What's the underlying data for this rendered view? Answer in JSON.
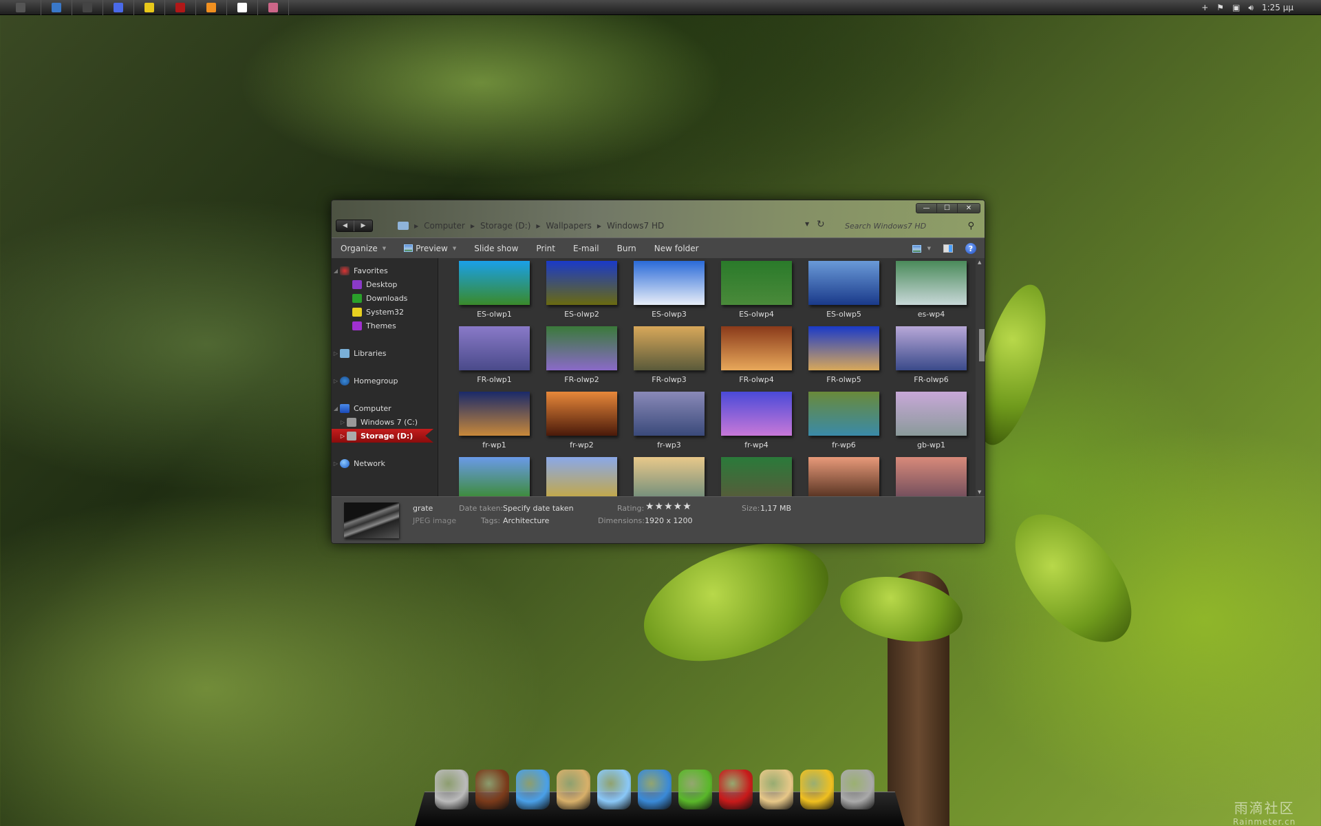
{
  "topbar": {
    "apps": [
      {
        "name": "apple-menu-icon",
        "color": "#555555"
      },
      {
        "name": "home-icon",
        "color": "#3a78c8"
      },
      {
        "name": "app-icon-dark",
        "color": "#444444"
      },
      {
        "name": "color-pen-icon",
        "color": "#4a6ae8"
      },
      {
        "name": "chrome-icon",
        "color": "#e8c81a"
      },
      {
        "name": "film-icon",
        "color": "#b01818"
      },
      {
        "name": "music-icon",
        "color": "#f09020"
      },
      {
        "name": "gmail-icon",
        "color": "#ffffff"
      },
      {
        "name": "paint-icon",
        "color": "#cc6688"
      }
    ],
    "tray": {
      "clock": "1:25 μμ"
    }
  },
  "window": {
    "nav_back": "◀",
    "nav_forward": "▶",
    "caption": {
      "minimize": "—",
      "maximize": "☐",
      "close": "✕"
    },
    "breadcrumb": [
      "Computer",
      "Storage (D:)",
      "Wallpapers",
      "Windows7 HD"
    ],
    "search_placeholder": "Search Windows7 HD",
    "toolbar": {
      "organize": "Organize",
      "preview": "Preview",
      "slideshow": "Slide show",
      "print": "Print",
      "email": "E-mail",
      "burn": "Burn",
      "new_folder": "New folder",
      "help": "?"
    },
    "nav_pane": {
      "favorites": "Favorites",
      "fav_items": [
        {
          "label": "Desktop",
          "color": "#8a3ac8"
        },
        {
          "label": "Downloads",
          "color": "#2aa02a"
        },
        {
          "label": "System32",
          "color": "#e8d020"
        },
        {
          "label": "Themes",
          "color": "#a030d0"
        }
      ],
      "libraries": "Libraries",
      "homegroup": "Homegroup",
      "computer": "Computer",
      "drives": [
        "Windows 7 (C:)",
        "Storage (D:)"
      ],
      "selected": "Storage (D:)",
      "network": "Network"
    },
    "files": [
      {
        "name": "ES-olwp1",
        "c1": "#1aa0e8",
        "c2": "#3a8a2a"
      },
      {
        "name": "ES-olwp2",
        "c1": "#1a3ac8",
        "c2": "#6a6a10"
      },
      {
        "name": "ES-olwp3",
        "c1": "#2a6ad8",
        "c2": "#e8eef8"
      },
      {
        "name": "ES-olwp4",
        "c1": "#2a7a2a",
        "c2": "#4a8a3a"
      },
      {
        "name": "ES-olwp5",
        "c1": "#6a9ad8",
        "c2": "#1a3a8a"
      },
      {
        "name": "es-wp4",
        "c1": "#4a8a5a",
        "c2": "#c8d8d8"
      },
      {
        "name": "FR-olwp1",
        "c1": "#8a7ac8",
        "c2": "#4a4a8a"
      },
      {
        "name": "FR-olwp2",
        "c1": "#3a7a3a",
        "c2": "#8a6ac8"
      },
      {
        "name": "FR-olwp3",
        "c1": "#d8a85a",
        "c2": "#5a5a3a"
      },
      {
        "name": "FR-olwp4",
        "c1": "#8a3a1a",
        "c2": "#e8a85a"
      },
      {
        "name": "FR-olwp5",
        "c1": "#1a3ac8",
        "c2": "#d8a85a"
      },
      {
        "name": "FR-olwp6",
        "c1": "#b8a8d8",
        "c2": "#3a4a8a"
      },
      {
        "name": "fr-wp1",
        "c1": "#1a2a6a",
        "c2": "#c8883a"
      },
      {
        "name": "fr-wp2",
        "c1": "#e8883a",
        "c2": "#4a1a0a"
      },
      {
        "name": "fr-wp3",
        "c1": "#8a8ab8",
        "c2": "#3a4a7a"
      },
      {
        "name": "fr-wp4",
        "c1": "#4a4ad8",
        "c2": "#c878d8"
      },
      {
        "name": "fr-wp6",
        "c1": "#6a8a3a",
        "c2": "#3a8aa8"
      },
      {
        "name": "gb-wp1",
        "c1": "#c8a8d8",
        "c2": "#8a9a9a"
      },
      {
        "name": "",
        "c1": "#6a9ae8",
        "c2": "#3a8a2a"
      },
      {
        "name": "",
        "c1": "#8aa8e8",
        "c2": "#c8a83a"
      },
      {
        "name": "",
        "c1": "#e8c88a",
        "c2": "#6a8a7a"
      },
      {
        "name": "",
        "c1": "#2a7a3a",
        "c2": "#5a5a3a"
      },
      {
        "name": "",
        "c1": "#e89a7a",
        "c2": "#4a2a1a"
      },
      {
        "name": "",
        "c1": "#d88a7a",
        "c2": "#6a4a5a"
      }
    ],
    "details": {
      "filename": "grate",
      "filetype": "JPEG image",
      "date_label": "Date taken:",
      "date_value": "Specify date taken",
      "tags_label": "Tags:",
      "tags_value": "Architecture",
      "rating_label": "Rating:",
      "rating_stars": "★★★★★",
      "rating_value": 0,
      "dims_label": "Dimensions:",
      "dims_value": "1920 x 1200",
      "size_label": "Size:",
      "size_value": "1,17 MB"
    }
  },
  "dock": {
    "items": [
      {
        "name": "dock-app-mask",
        "color": "#bbbbbb"
      },
      {
        "name": "dock-app-domo",
        "color": "#7a3a1a"
      },
      {
        "name": "dock-app-cloud",
        "color": "#4aa0e8"
      },
      {
        "name": "dock-app-xcode",
        "color": "#d8b06a"
      },
      {
        "name": "dock-app-yawn",
        "color": "#8ac8f8"
      },
      {
        "name": "dock-app-twitter-egg",
        "color": "#3a8ad8"
      },
      {
        "name": "dock-app-green-bird",
        "color": "#5ab82a"
      },
      {
        "name": "dock-app-chair",
        "color": "#c81a1a"
      },
      {
        "name": "dock-app-box",
        "color": "#e8c888"
      },
      {
        "name": "dock-app-drive",
        "color": "#f0c020"
      },
      {
        "name": "dock-trash",
        "color": "#aaaaaa"
      }
    ]
  },
  "watermark": {
    "cn": "雨滴社区",
    "en": "Rainmeter.cn"
  }
}
